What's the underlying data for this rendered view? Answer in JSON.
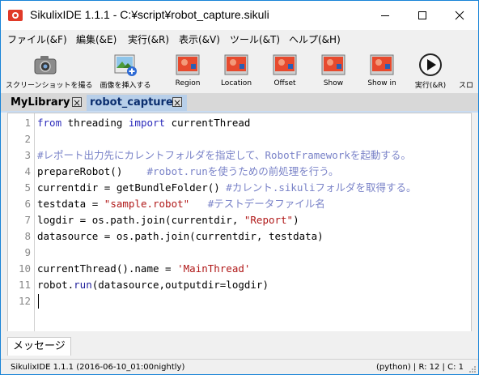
{
  "window": {
    "title": "SikulixIDE 1.1.1 - C:¥script¥robot_capture.sikuli"
  },
  "menu": [
    {
      "name": "menu-file",
      "label": "ファイル(&F)"
    },
    {
      "name": "menu-edit",
      "label": "編集(&E)"
    },
    {
      "name": "menu-run",
      "label": "実行(&R)"
    },
    {
      "name": "menu-view",
      "label": "表示(&V)"
    },
    {
      "name": "menu-tools",
      "label": "ツール(&T)"
    },
    {
      "name": "menu-help",
      "label": "ヘルプ(&H)"
    }
  ],
  "toolbar": {
    "screenshot": "スクリーンショットを撮る",
    "insert_image": "画像を挿入する",
    "region": "Region",
    "location": "Location",
    "offset": "Offset",
    "show": "Show",
    "show_in": "Show in",
    "run": "実行(&R)",
    "slow_run": "スロ"
  },
  "tabs": {
    "library": "MyLibrary",
    "active": "robot_capture"
  },
  "editor": {
    "line_numbers": [
      "1",
      "2",
      "3",
      "4",
      "5",
      "6",
      "7",
      "8",
      "9",
      "10",
      "11",
      "12"
    ],
    "lines": [
      [
        {
          "t": "from",
          "c": "kw"
        },
        {
          "t": " threading ",
          "c": ""
        },
        {
          "t": "import",
          "c": "kw"
        },
        {
          "t": " currentThread",
          "c": ""
        }
      ],
      [],
      [
        {
          "t": "#レポート出力先にカレントフォルダを指定して、RobotFrameworkを起動する。",
          "c": "cm"
        }
      ],
      [
        {
          "t": "prepareRobot()    ",
          "c": ""
        },
        {
          "t": "#robot.runを使うための前処理を行う。",
          "c": "cm"
        }
      ],
      [
        {
          "t": "currentdir = getBundleFolder() ",
          "c": ""
        },
        {
          "t": "#カレント.sikuliフォルダを取得する。",
          "c": "cm"
        }
      ],
      [
        {
          "t": "testdata = ",
          "c": ""
        },
        {
          "t": "\"sample.robot\"",
          "c": "str"
        },
        {
          "t": "   ",
          "c": ""
        },
        {
          "t": "#テストデータファイル名",
          "c": "cm"
        }
      ],
      [
        {
          "t": "logdir = os.path.join(currentdir, ",
          "c": ""
        },
        {
          "t": "\"Report\"",
          "c": "str"
        },
        {
          "t": ")",
          "c": ""
        }
      ],
      [
        {
          "t": "datasource = os.path.join(currentdir, testdata)",
          "c": ""
        }
      ],
      [],
      [
        {
          "t": "currentThread().name = ",
          "c": ""
        },
        {
          "t": "'MainThread'",
          "c": "str"
        }
      ],
      [
        {
          "t": "robot.",
          "c": ""
        },
        {
          "t": "run",
          "c": "fn"
        },
        {
          "t": "(datasource,outputdir=logdir)",
          "c": ""
        }
      ],
      []
    ]
  },
  "messages": {
    "tab_label": "メッセージ"
  },
  "status": {
    "left": "SikulixIDE 1.1.1 (2016-06-10_01:00nightly)",
    "right": "(python) | R: 12 | C: 1"
  }
}
